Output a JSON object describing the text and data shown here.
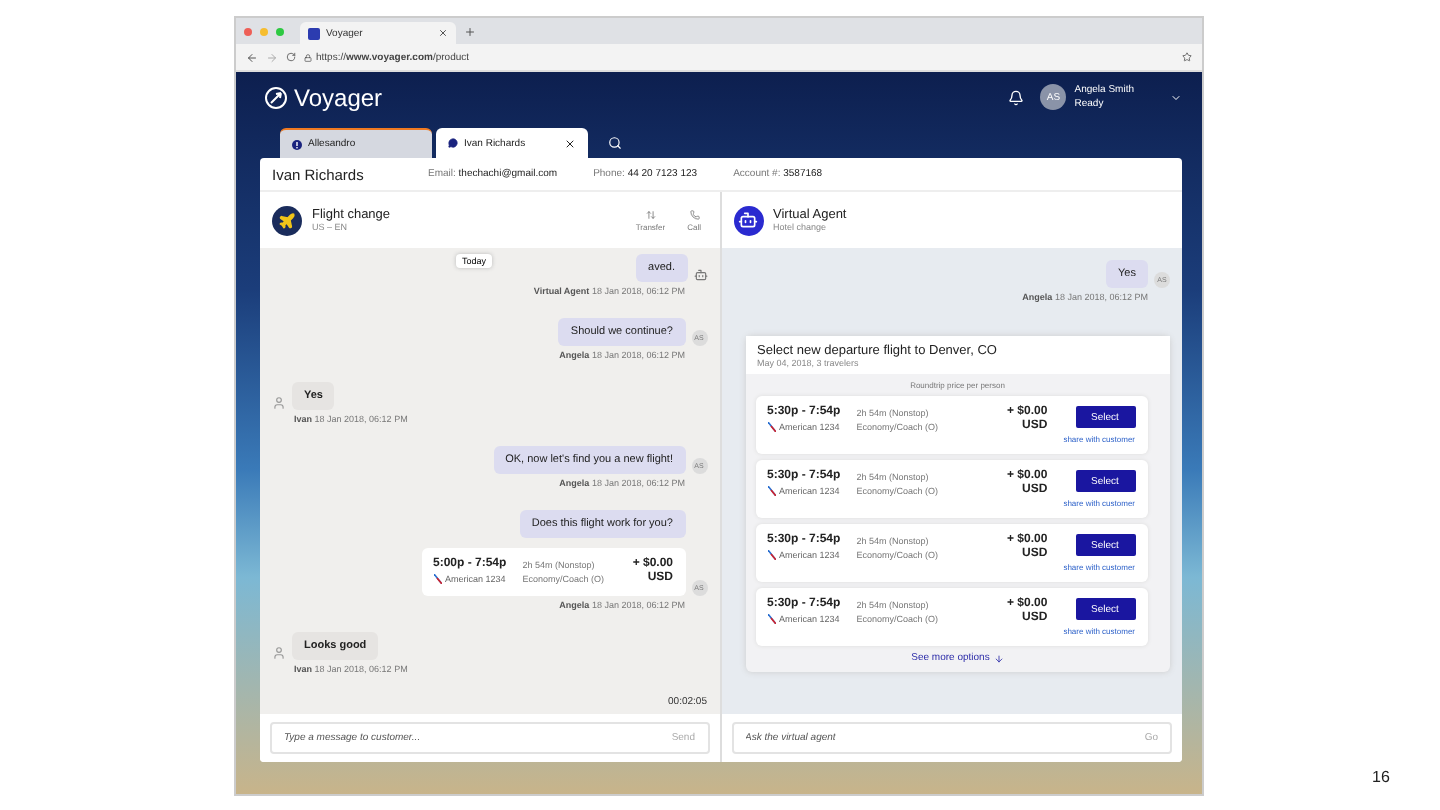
{
  "browser": {
    "tab_title": "Voyager",
    "url": "https://**www.voyager.com**/product"
  },
  "header": {
    "logo": "Voyager",
    "user_initials": "AS",
    "user_name": "Angela Smith",
    "user_status": "Ready"
  },
  "tabs": [
    {
      "label": "Allesandro",
      "selected": false,
      "alert": true
    },
    {
      "label": "Ivan Richards",
      "selected": true,
      "alert": false
    }
  ],
  "customer": {
    "name": "Ivan Richards",
    "fields": [
      {
        "label": "Email:",
        "value": "thechachi@gmail.com"
      },
      {
        "label": "Phone:",
        "value": "44 20 7123 123"
      },
      {
        "label": "Account #:",
        "value": "3587168"
      }
    ]
  },
  "conversation": {
    "title": "Flight change",
    "subtitle": "US – EN",
    "actions": [
      "Transfer",
      "Call"
    ],
    "day_label": "Today",
    "timer": "00:02:05",
    "input_placeholder": "Type a message to customer...",
    "send_label": "Send",
    "messages": [
      {
        "kind": "outgoing",
        "text": "aved.",
        "author": "Virtual Agent",
        "time": "18 Jan 2018, 06:12 PM",
        "avatar": {
          "kind": "bot"
        }
      },
      {
        "kind": "outgoing",
        "text": "Should we continue?",
        "author": "Angela",
        "time": "18 Jan 2018, 06:12 PM",
        "avatar": {
          "kind": "initials",
          "text": "AS"
        }
      },
      {
        "kind": "incoming",
        "text": "Yes",
        "author": "Ivan",
        "time": "18 Jan 2018, 06:12 PM",
        "avatar": {
          "kind": "person"
        }
      },
      {
        "kind": "outgoing",
        "text": "OK, now let's find you a new flight!",
        "author": "Angela",
        "time": "18 Jan 2018, 06:12 PM",
        "avatar": {
          "kind": "initials",
          "text": "AS"
        }
      },
      {
        "kind": "outgoing",
        "text": "Does this flight work for you?"
      },
      {
        "kind": "flight",
        "flight": {
          "times": "5:00p - 7:54p",
          "airline": "American 1234",
          "duration": "2h 54m (Nonstop)",
          "cabin": "Economy/Coach (O)",
          "price": "+ $0.00",
          "currency": "USD"
        },
        "author": "Angela",
        "time": "18 Jan 2018, 06:12 PM",
        "avatar": {
          "kind": "initials",
          "text": "AS"
        }
      },
      {
        "kind": "incoming",
        "text": "Looks good",
        "author": "Ivan",
        "time": "18 Jan 2018, 06:12 PM",
        "avatar": {
          "kind": "person"
        }
      }
    ]
  },
  "virtual_agent": {
    "title": "Virtual Agent",
    "subtitle": "Hotel change",
    "input_placeholder": "Ask the virtual agent",
    "go_label": "Go",
    "message": {
      "text": "Yes",
      "author": "Angela",
      "time": "18 Jan 2018, 06:12 PM",
      "avatar": "AS"
    },
    "offer": {
      "title": "Select new departure flight to Denver, CO",
      "subtitle": "May 04, 2018, 3 travelers",
      "price_note": "Roundtrip price per person",
      "more_label": "See more options",
      "flights": [
        {
          "times": "5:30p - 7:54p",
          "airline": "American 1234",
          "duration": "2h 54m (Nonstop)",
          "cabin": "Economy/Coach (O)",
          "price": "+ $0.00",
          "currency": "USD",
          "button": "Select",
          "link": "share with customer"
        },
        {
          "times": "5:30p - 7:54p",
          "airline": "American 1234",
          "duration": "2h 54m (Nonstop)",
          "cabin": "Economy/Coach (O)",
          "price": "+ $0.00",
          "currency": "USD",
          "button": "Select",
          "link": "share with customer"
        },
        {
          "times": "5:30p - 7:54p",
          "airline": "American 1234",
          "duration": "2h 54m (Nonstop)",
          "cabin": "Economy/Coach (O)",
          "price": "+ $0.00",
          "currency": "USD",
          "button": "Select",
          "link": "share with customer"
        },
        {
          "times": "5:30p - 7:54p",
          "airline": "American 1234",
          "duration": "2h 54m (Nonstop)",
          "cabin": "Economy/Coach (O)",
          "price": "+ $0.00",
          "currency": "USD",
          "button": "Select",
          "link": "share with customer"
        }
      ]
    }
  },
  "page_number": "16"
}
